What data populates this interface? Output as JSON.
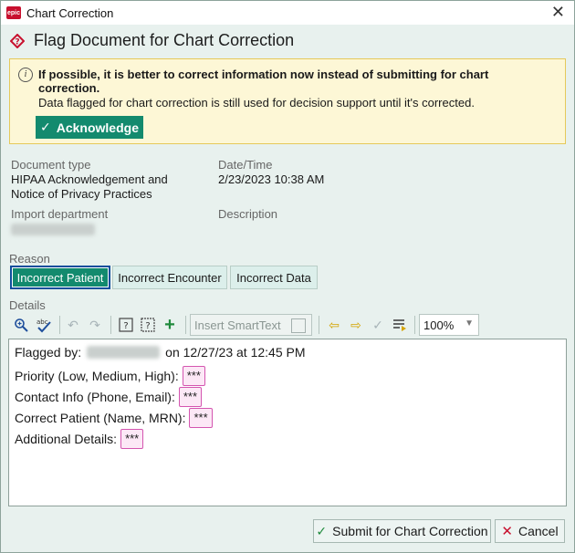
{
  "window": {
    "title": "Chart Correction",
    "logo_text": "epic"
  },
  "heading": "Flag Document for Chart Correction",
  "warning": {
    "bold": "If possible, it is better to correct information now instead of submitting for chart correction.",
    "sub": "Data flagged for chart correction is still used for decision support until it's corrected.",
    "acknowledge_label": "Acknowledge"
  },
  "fields": {
    "doc_type_label": "Document type",
    "doc_type_value_line1": "HIPAA Acknowledgement and",
    "doc_type_value_line2": "Notice of Privacy Practices",
    "datetime_label": "Date/Time",
    "datetime_value": "2/23/2023 10:38 AM",
    "import_dept_label": "Import department",
    "description_label": "Description"
  },
  "reason": {
    "label": "Reason",
    "options": [
      "Incorrect Patient",
      "Incorrect Encounter",
      "Incorrect Data"
    ],
    "selected": "Incorrect Patient"
  },
  "details": {
    "label": "Details",
    "smarttext_placeholder": "Insert SmartText",
    "zoom": "100%",
    "lines": [
      {
        "label": "Flagged by:",
        "suffix": "on 12/27/23 at 12:45 PM"
      },
      {
        "label": "Priority (Low, Medium, High):",
        "field": "***"
      },
      {
        "label": "Contact Info (Phone, Email):",
        "field": "***"
      },
      {
        "label": "Correct Patient (Name, MRN):",
        "field": "***"
      },
      {
        "label": "Additional Details:",
        "field": "***"
      }
    ]
  },
  "footer": {
    "submit_label": "Submit for Chart Correction",
    "cancel_label": "Cancel"
  },
  "colors": {
    "accent": "#138a6e",
    "warning_bg": "#fdf7d6",
    "smartfield_border": "#d455b0"
  }
}
